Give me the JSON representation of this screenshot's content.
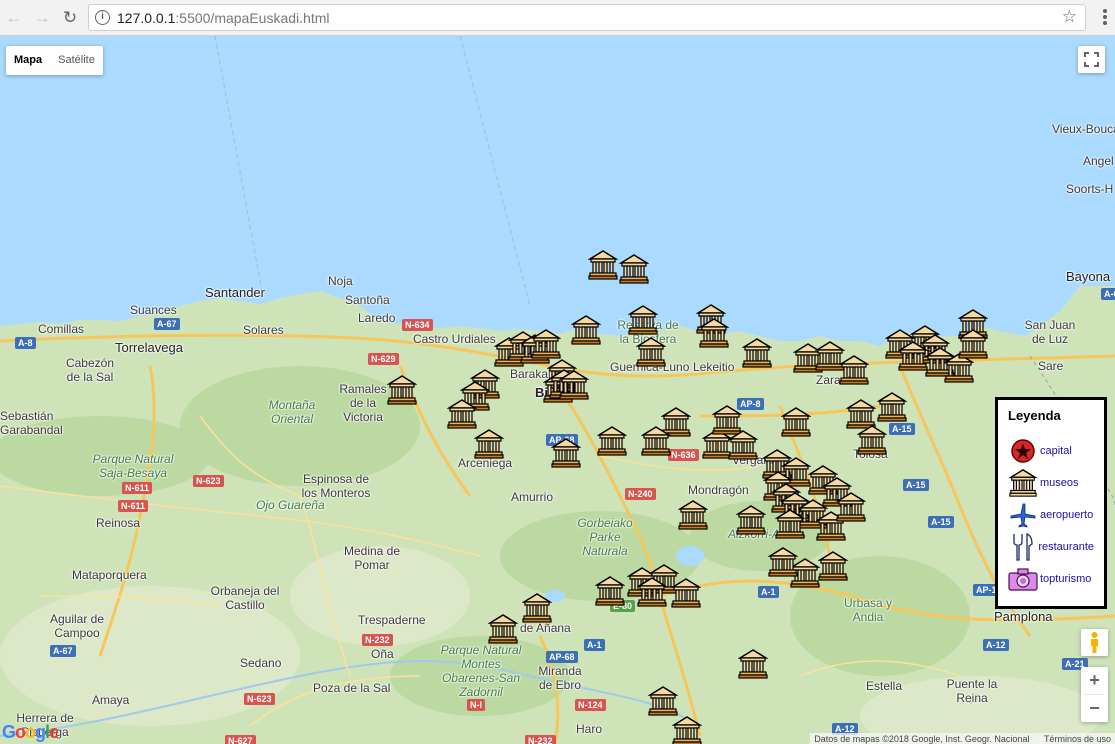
{
  "browser": {
    "url_host": "127.0.0.1",
    "url_rest": ":5500/mapaEuskadi.html"
  },
  "map_controls": {
    "map_label": "Mapa",
    "satellite_label": "Satélite",
    "zoom_in": "+",
    "zoom_out": "−"
  },
  "places": {
    "santander": "Santander",
    "noja": "Noja",
    "santona": "Santoña",
    "suances": "Suances",
    "comillas": "Comillas",
    "laredo": "Laredo",
    "torrelavega": "Torrelavega",
    "solares": "Solares",
    "castro_urdiales": "Castro Urdiales",
    "cabezon": "Cabezón de la Sal",
    "ramales": "Ramales de la Victoria",
    "montana_oriental": "Montaña Oriental",
    "sebastian": "Sebastián Garabandal",
    "parque_saja": "Parque Natural Saja-Besaya",
    "espinosa": "Espinosa de los Monteros",
    "ojo_guarena": "Ojo Guareña",
    "reinosa": "Reinosa",
    "mataporquera": "Mataporquera",
    "medina": "Medina de Pomar",
    "orbaneja": "Orbaneja del Castillo",
    "aguilar": "Aguilar de Campoo",
    "trespaderne": "Trespaderne",
    "ona": "Oña",
    "sedano": "Sedano",
    "poza": "Poza de la Sal",
    "herrera": "Herrera de Pisuerga",
    "amaya": "Amaya",
    "bilbao": "Bilbao",
    "barakaldo": "Barakaldo",
    "arceniega": "Arceniega",
    "amurrio": "Amurrio",
    "gorbeiako": "Gorbeiako Parke Naturala",
    "guernica": "Guernica-Luno",
    "lekeitio": "Lekeitio",
    "reserva": "Reserva de la Biosfera",
    "zarautz": "Zarautz",
    "tolosa": "Tolosa",
    "vergara": "Vergara",
    "mondragon": "Mondragón",
    "aizkorri": "Aizkorri-Aratz",
    "miranda": "Miranda de Ebro",
    "anana": "de Añana",
    "parque_montes": "Parque Natural Montes Obarenes-San Zadornil",
    "urbasa": "Urbasa y Andia",
    "estella": "Estella",
    "puente": "Puente la Reina",
    "pamplona": "Pamplona",
    "bayonne": "Bayona",
    "san_juan": "San Juan de Luz",
    "sare": "Sare",
    "vieux": "Vieux-Boucau",
    "soorts": "Soorts-H",
    "nacional": "Nacional",
    "haro": "Haro",
    "angel": "Angel"
  },
  "shields": {
    "a67_top": "A-67",
    "a8_left": "A-8",
    "n634": "N-634",
    "n629": "N-629",
    "n623": "N-623",
    "n611_a": "N-611",
    "n611_b": "N-611",
    "a67_bottom": "A-67",
    "n232": "N-232",
    "n623_b": "N-623",
    "n627": "N-627",
    "ap8": "AP-8",
    "ap68_top": "AP-68",
    "n636": "N-636",
    "n240": "N-240",
    "e80": "E-80",
    "a1_a": "A-1",
    "a1_b": "A-1",
    "ap68": "AP-68",
    "n1": "N-I",
    "n124": "N-124",
    "n232_b": "N-232",
    "a15_a": "A-15",
    "a15_b": "A-15",
    "a15_top": "A-15",
    "ap15": "AP-1",
    "a12_a": "A-12",
    "a12_b": "A-12",
    "a21": "A-21",
    "a63": "A-6"
  },
  "legend": {
    "title": "Leyenda",
    "items": [
      {
        "label": "capital",
        "icon": "capital-icon"
      },
      {
        "label": "museos",
        "icon": "museum-icon"
      },
      {
        "label": "aeropuerto",
        "icon": "airplane-icon"
      },
      {
        "label": "restaurante",
        "icon": "restaurant-icon"
      },
      {
        "label": "topturismo",
        "icon": "camera-icon"
      }
    ]
  },
  "attribution": {
    "data": "Datos de mapas ©2018 Google, Inst. Geogr. Nacional",
    "terms": "Términos de uso"
  },
  "google_logo": "Google",
  "colors": {
    "sea": "#aadaff",
    "land": "#cfe3b9",
    "road": "#f6c65b"
  }
}
